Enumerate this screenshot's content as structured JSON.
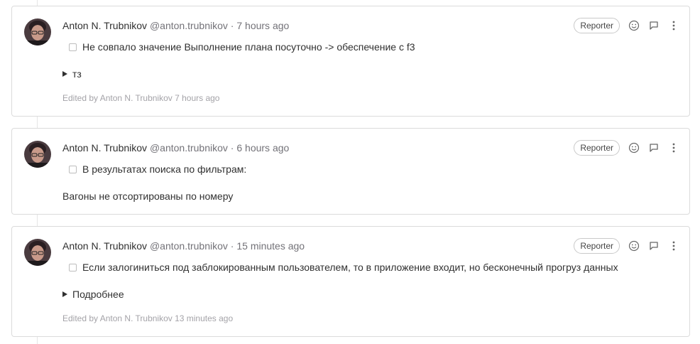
{
  "notes": [
    {
      "author_name": "Anton N. Trubnikov",
      "author_handle": "@anton.trubnikov",
      "separator": "·",
      "time": "7 hours ago",
      "role": "Reporter",
      "task_text": "Не совпало значение Выполнение плана посуточно -> обеспечение с f3",
      "task_checked": false,
      "details_summary": "тз",
      "edited_text": "Edited by Anton N. Trubnikov 7 hours ago"
    },
    {
      "author_name": "Anton N. Trubnikov",
      "author_handle": "@anton.trubnikov",
      "separator": "·",
      "time": "6 hours ago",
      "role": "Reporter",
      "task_text": "В результатах поиска по фильтрам:",
      "task_checked": false,
      "body_text": "Вагоны не отсортированы по номеру"
    },
    {
      "author_name": "Anton N. Trubnikov",
      "author_handle": "@anton.trubnikov",
      "separator": "·",
      "time": "15 minutes ago",
      "role": "Reporter",
      "task_text": "Если залогиниться под заблокированным пользователем, то в приложение входит, но бесконечный прогруз данных",
      "task_checked": false,
      "details_summary": "Подробнее",
      "edited_text": "Edited by Anton N. Trubnikov 13 minutes ago"
    }
  ],
  "icons": {
    "emoji": "smiley-icon",
    "reply": "comment-icon",
    "more": "more-vertical-icon"
  },
  "colors": {
    "text": "#303030",
    "muted": "#737278",
    "edited": "#a4a3a8",
    "border": "#dbdbdb",
    "icon": "#666666"
  }
}
